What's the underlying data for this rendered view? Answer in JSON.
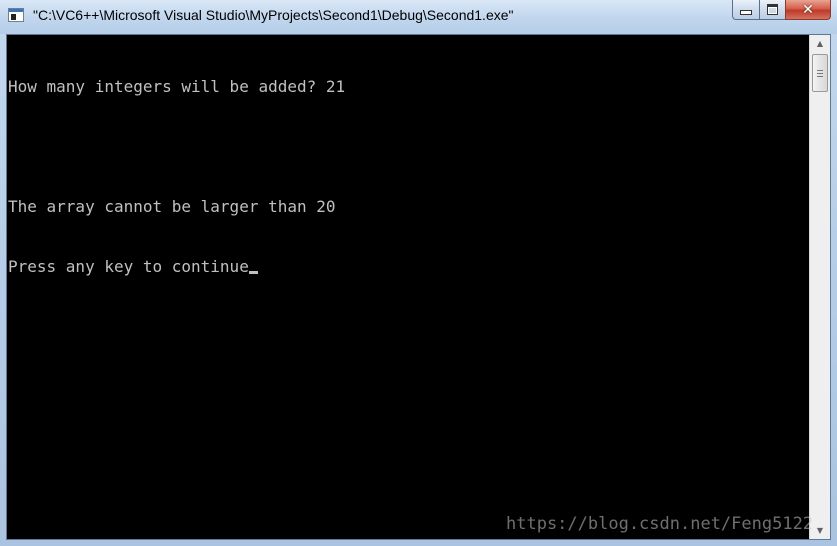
{
  "window": {
    "title": "\"C:\\VC6++\\Microsoft Visual Studio\\MyProjects\\Second1\\Debug\\Second1.exe\"",
    "icon": "console-app-icon",
    "buttons": {
      "minimize": "minimize-icon",
      "maximize": "maximize-icon",
      "close": "close-icon"
    },
    "close_glyph": "✕"
  },
  "console": {
    "lines": [
      "How many integers will be added? 21",
      "",
      "The array cannot be larger than 20",
      "Press any key to continue"
    ],
    "colors": {
      "background": "#000000",
      "foreground": "#c0c0c0"
    }
  },
  "scrollbar": {
    "up_arrow": "▲",
    "down_arrow": "▼"
  },
  "watermark": "https://blog.csdn.net/Feng5122"
}
